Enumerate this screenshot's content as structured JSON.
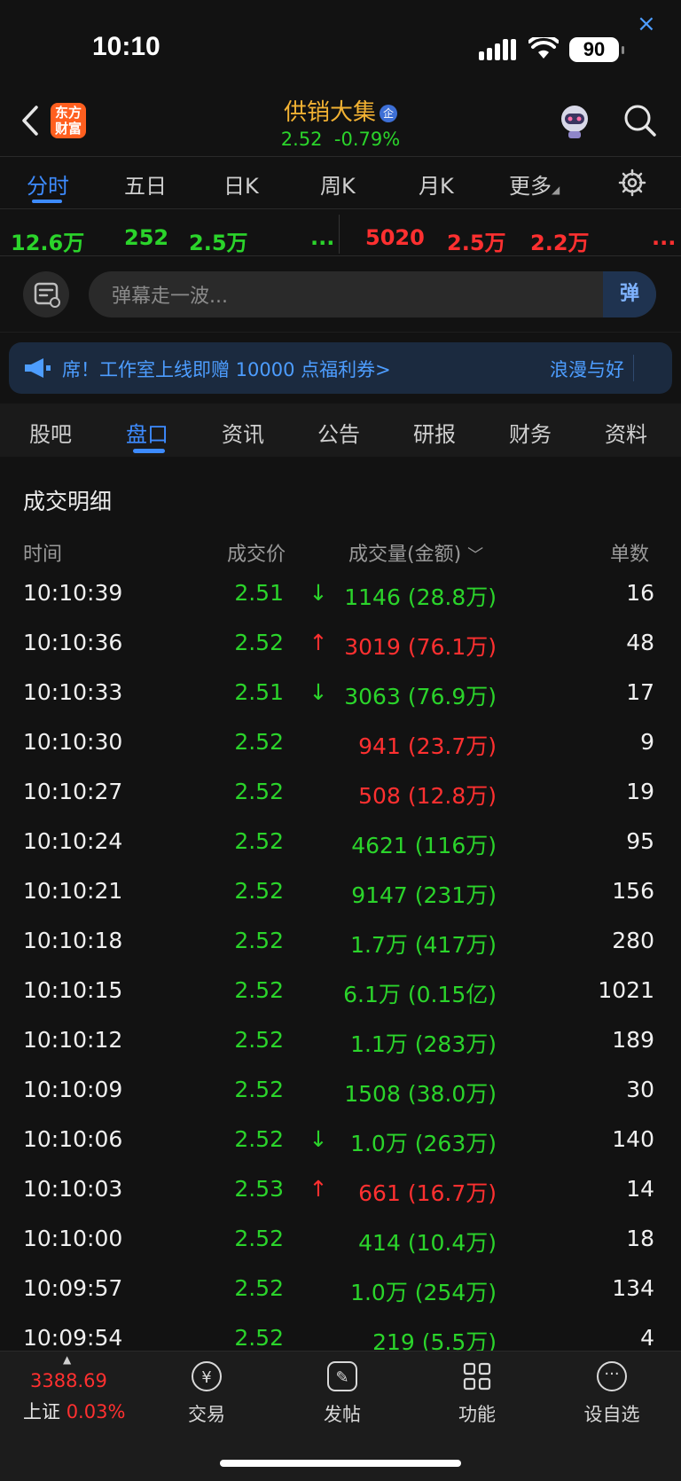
{
  "status_bar": {
    "time": "10:10",
    "battery": "90"
  },
  "header": {
    "logo_line1": "东方",
    "logo_line2": "财富",
    "stock_name": "供销大集",
    "badge": "企",
    "price": "2.52",
    "change": "-0.79%"
  },
  "chart_tabs": [
    "分时",
    "五日",
    "日K",
    "周K",
    "月K",
    "更多"
  ],
  "stats_left": [
    "12.6万",
    "252",
    "2.5万",
    "..."
  ],
  "stats_right": [
    "5020",
    "2.5万",
    "2.2万",
    "..."
  ],
  "danmu": {
    "placeholder": "弹幕走一波...",
    "button": "弹"
  },
  "banner": {
    "text": "席！工作室上线即赠 10000 点福利券>",
    "right": "浪漫与好"
  },
  "section_tabs": [
    "股吧",
    "盘口",
    "资讯",
    "公告",
    "研报",
    "财务",
    "资料"
  ],
  "trades": {
    "title": "成交明细",
    "headers": {
      "time": "时间",
      "price": "成交价",
      "volume": "成交量(金额)",
      "count": "单数"
    },
    "rows": [
      {
        "time": "10:10:39",
        "price": "2.51",
        "arrow": "↓",
        "volume": "1146 (28.8万)",
        "count": "16",
        "pc": "g",
        "vc": "g"
      },
      {
        "time": "10:10:36",
        "price": "2.52",
        "arrow": "↑",
        "volume": "3019 (76.1万)",
        "count": "48",
        "pc": "g",
        "vc": "r"
      },
      {
        "time": "10:10:33",
        "price": "2.51",
        "arrow": "↓",
        "volume": "3063 (76.9万)",
        "count": "17",
        "pc": "g",
        "vc": "g"
      },
      {
        "time": "10:10:30",
        "price": "2.52",
        "arrow": "",
        "volume": "941 (23.7万)",
        "count": "9",
        "pc": "g",
        "vc": "r"
      },
      {
        "time": "10:10:27",
        "price": "2.52",
        "arrow": "",
        "volume": "508 (12.8万)",
        "count": "19",
        "pc": "g",
        "vc": "r"
      },
      {
        "time": "10:10:24",
        "price": "2.52",
        "arrow": "",
        "volume": "4621 (116万)",
        "count": "95",
        "pc": "g",
        "vc": "g"
      },
      {
        "time": "10:10:21",
        "price": "2.52",
        "arrow": "",
        "volume": "9147 (231万)",
        "count": "156",
        "pc": "g",
        "vc": "g"
      },
      {
        "time": "10:10:18",
        "price": "2.52",
        "arrow": "",
        "volume": "1.7万 (417万)",
        "count": "280",
        "pc": "g",
        "vc": "g"
      },
      {
        "time": "10:10:15",
        "price": "2.52",
        "arrow": "",
        "volume": "6.1万 (0.15亿)",
        "count": "1021",
        "pc": "g",
        "vc": "g"
      },
      {
        "time": "10:10:12",
        "price": "2.52",
        "arrow": "",
        "volume": "1.1万 (283万)",
        "count": "189",
        "pc": "g",
        "vc": "g"
      },
      {
        "time": "10:10:09",
        "price": "2.52",
        "arrow": "",
        "volume": "1508 (38.0万)",
        "count": "30",
        "pc": "g",
        "vc": "g"
      },
      {
        "time": "10:10:06",
        "price": "2.52",
        "arrow": "↓",
        "volume": "1.0万 (263万)",
        "count": "140",
        "pc": "g",
        "vc": "g"
      },
      {
        "time": "10:10:03",
        "price": "2.53",
        "arrow": "↑",
        "volume": "661 (16.7万)",
        "count": "14",
        "pc": "g",
        "vc": "r"
      },
      {
        "time": "10:10:00",
        "price": "2.52",
        "arrow": "",
        "volume": "414 (10.4万)",
        "count": "18",
        "pc": "g",
        "vc": "g"
      },
      {
        "time": "10:09:57",
        "price": "2.52",
        "arrow": "",
        "volume": "1.0万 (254万)",
        "count": "134",
        "pc": "g",
        "vc": "g"
      },
      {
        "time": "10:09:54",
        "price": "2.52",
        "arrow": "",
        "volume": "219 (5.5万)",
        "count": "4",
        "pc": "g",
        "vc": "g"
      }
    ]
  },
  "bottom_nav": {
    "index_value": "3388.69",
    "index_name": "上证",
    "index_change": "0.03%",
    "items": [
      "交易",
      "发帖",
      "功能",
      "设自选"
    ]
  },
  "colors": {
    "up": "#ff3030",
    "down": "#2bd42b",
    "accent": "#3d8bff",
    "brand": "#f2b233"
  }
}
